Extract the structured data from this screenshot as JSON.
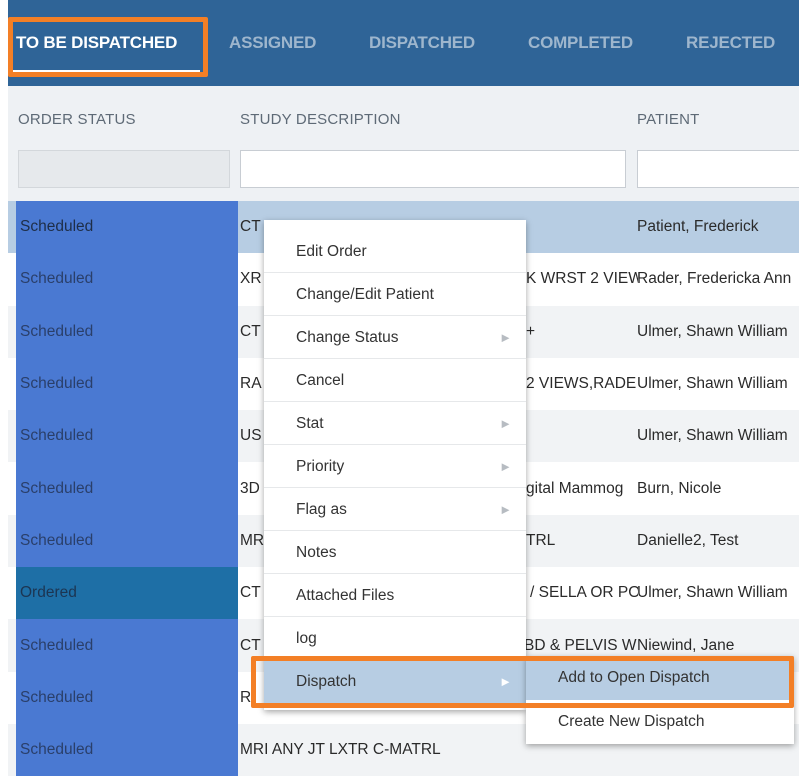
{
  "tabs": [
    {
      "label": "TO BE DISPATCHED",
      "active": true
    },
    {
      "label": "ASSIGNED"
    },
    {
      "label": "DISPATCHED"
    },
    {
      "label": "COMPLETED"
    },
    {
      "label": "REJECTED"
    }
  ],
  "columns": {
    "status": "ORDER STATUS",
    "study": "STUDY DESCRIPTION",
    "patient": "PATIENT"
  },
  "filters": {
    "status": "",
    "study": "",
    "patient": ""
  },
  "rows": [
    {
      "status": "Scheduled",
      "study_left": "CT",
      "study_right": "",
      "patient": "Patient, Frederick"
    },
    {
      "status": "Scheduled",
      "study_left": "XR",
      "study_right": "K WRST 2 VIEW",
      "patient": "Rader, Fredericka Ann"
    },
    {
      "status": "Scheduled",
      "study_left": "CT",
      "study_right": "+",
      "patient": "Ulmer, Shawn William"
    },
    {
      "status": "Scheduled",
      "study_left": "RA",
      "study_right": "2 VIEWS,RADE",
      "patient": "Ulmer, Shawn William"
    },
    {
      "status": "Scheduled",
      "study_left": "US",
      "study_right": "",
      "patient": "Ulmer, Shawn William"
    },
    {
      "status": "Scheduled",
      "study_left": "3D",
      "study_right": "gital Mammog",
      "patient": "Burn, Nicole"
    },
    {
      "status": "Scheduled",
      "study_left": "MR",
      "study_right": "TRL",
      "patient": "Danielle2, Test"
    },
    {
      "status": "Ordered",
      "study_left": "CT",
      "study_right": "/ SELLA OR PO",
      "patient": "Ulmer, Shawn William"
    },
    {
      "status": "Scheduled",
      "study_left": "CT",
      "study_right": "BD & PELVIS W",
      "patient": "Niewind, Jane"
    },
    {
      "status": "Scheduled",
      "study_left": "R",
      "study_right": "",
      "patient": ""
    },
    {
      "status": "Scheduled",
      "study_left": "MRI ANY JT LXTR C-MATRL",
      "study_right": "",
      "patient": ""
    }
  ],
  "context_menu": [
    {
      "label": "Edit Order",
      "submenu": false
    },
    {
      "label": "Change/Edit Patient",
      "submenu": false
    },
    {
      "label": "Change Status",
      "submenu": true
    },
    {
      "label": "Cancel",
      "submenu": false
    },
    {
      "label": "Stat",
      "submenu": true
    },
    {
      "label": "Priority",
      "submenu": true
    },
    {
      "label": "Flag as",
      "submenu": true
    },
    {
      "label": "Notes",
      "submenu": false
    },
    {
      "label": "Attached Files",
      "submenu": false
    },
    {
      "label": "log",
      "submenu": false
    },
    {
      "label": "Dispatch",
      "submenu": true
    }
  ],
  "dispatch_submenu": [
    "Add to Open Dispatch",
    "Create New Dispatch"
  ],
  "colors": {
    "tab_bar": "#2f6497",
    "highlight": "#f37f26",
    "status_cell": "#4a79d2",
    "ordered_cell": "#1e6fa6",
    "selected_row": "#b7cde3"
  }
}
